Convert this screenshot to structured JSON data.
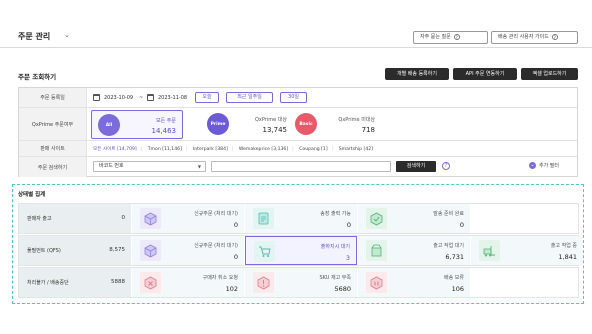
{
  "header": {
    "title": "주문 관리",
    "faq_label": "자주 묻는 질문",
    "guide_label": "배송 관리 사용자 가이드"
  },
  "section": {
    "title": "주문 조회하기",
    "buttons": [
      "개별 배송 등록하기",
      "API 주문 연동하기",
      "엑셀 업로드하기"
    ]
  },
  "filters": {
    "date": {
      "label": "주문 등록일",
      "start": "2023-10-09",
      "sep": "~",
      "end": "2023-11-08",
      "quick": [
        "오늘",
        "최근 일주일",
        "30일"
      ]
    },
    "qxprime": {
      "label": "QxPrime 주문여부",
      "cards": [
        {
          "badge": "All",
          "label": "모든 주문",
          "value": "14,463",
          "color": "#7b6cd9"
        },
        {
          "badge": "Prime",
          "label": "QxPrime 대상",
          "value": "13,745",
          "color": "#6b5cd6"
        },
        {
          "badge": "Basic",
          "label": "QxPrime 미대상",
          "value": "718",
          "color": "#e85a6a"
        }
      ]
    },
    "sites": {
      "label": "판매 사이트",
      "items": [
        "모든 사이트 [14,709]",
        "Tmon [11,146]",
        "Interpark [384]",
        "Wemakeprice [3,136]",
        "Coupang [1]",
        "Smartship [42]"
      ]
    },
    "search": {
      "label": "주문 검색하기",
      "select_value": "바코드 번호",
      "search_button": "검색하기",
      "help": "?",
      "add_filter": "추가 필터"
    }
  },
  "status": {
    "title": "상태별 집계",
    "rows": [
      {
        "label": "판매자 출고",
        "total": "0",
        "cells": [
          {
            "label": "신규주문 (처리 대기)",
            "value": "0",
            "icon": "box-icon",
            "tone": "purple"
          },
          {
            "label": "송장 출력 가능",
            "value": "0",
            "icon": "printer-icon",
            "tone": "teal"
          },
          {
            "label": "발송 준비 완료",
            "value": "0",
            "icon": "package-ready-icon",
            "tone": "green"
          }
        ]
      },
      {
        "label": "풀필먼트 (QFS)",
        "total": "8,575",
        "cells": [
          {
            "label": "신규주문 (처리 대기)",
            "value": "0",
            "icon": "box-icon",
            "tone": "purple"
          },
          {
            "label": "출하지시 대기",
            "value": "3",
            "icon": "cart-icon",
            "tone": "teal",
            "selected": true
          },
          {
            "label": "출고 작업 대기",
            "value": "6,731",
            "icon": "box-open-icon",
            "tone": "green"
          },
          {
            "label": "출고 작업 중",
            "value": "1,841",
            "icon": "forklift-icon",
            "tone": "green"
          }
        ]
      },
      {
        "label": "처리불가 / 배송중단",
        "total": "5888",
        "cells": [
          {
            "label": "구매자 취소 요청",
            "value": "102",
            "icon": "cancel-box-icon",
            "tone": "pink"
          },
          {
            "label": "SKU 재고 부족",
            "value": "5680",
            "icon": "stock-short-icon",
            "tone": "pink"
          },
          {
            "label": "배송 보류",
            "value": "106",
            "icon": "hold-box-icon",
            "tone": "pink"
          }
        ]
      }
    ]
  }
}
